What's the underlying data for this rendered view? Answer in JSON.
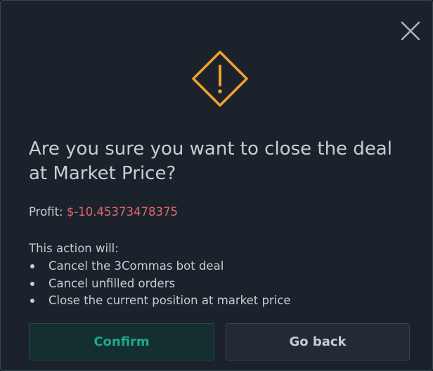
{
  "dialog": {
    "title": "Are you sure you want to close the deal at Market Price?",
    "profit_label": "Profit:",
    "profit_value": "$-10.45373478375",
    "actions_intro": "This action will:",
    "actions": [
      "Cancel the 3Commas bot deal",
      "Cancel unfilled orders",
      "Close the current position at market price"
    ],
    "confirm_label": "Confirm",
    "back_label": "Go back"
  },
  "icons": {
    "close": "close-icon",
    "warning": "warning-icon"
  },
  "colors": {
    "background": "#1b222b",
    "text": "#c8cdd2",
    "warning": "#f0a030",
    "profit_negative": "#e3676f",
    "confirm_text": "#1fa78f",
    "confirm_bg": "#152f31",
    "back_bg": "#222b35"
  }
}
